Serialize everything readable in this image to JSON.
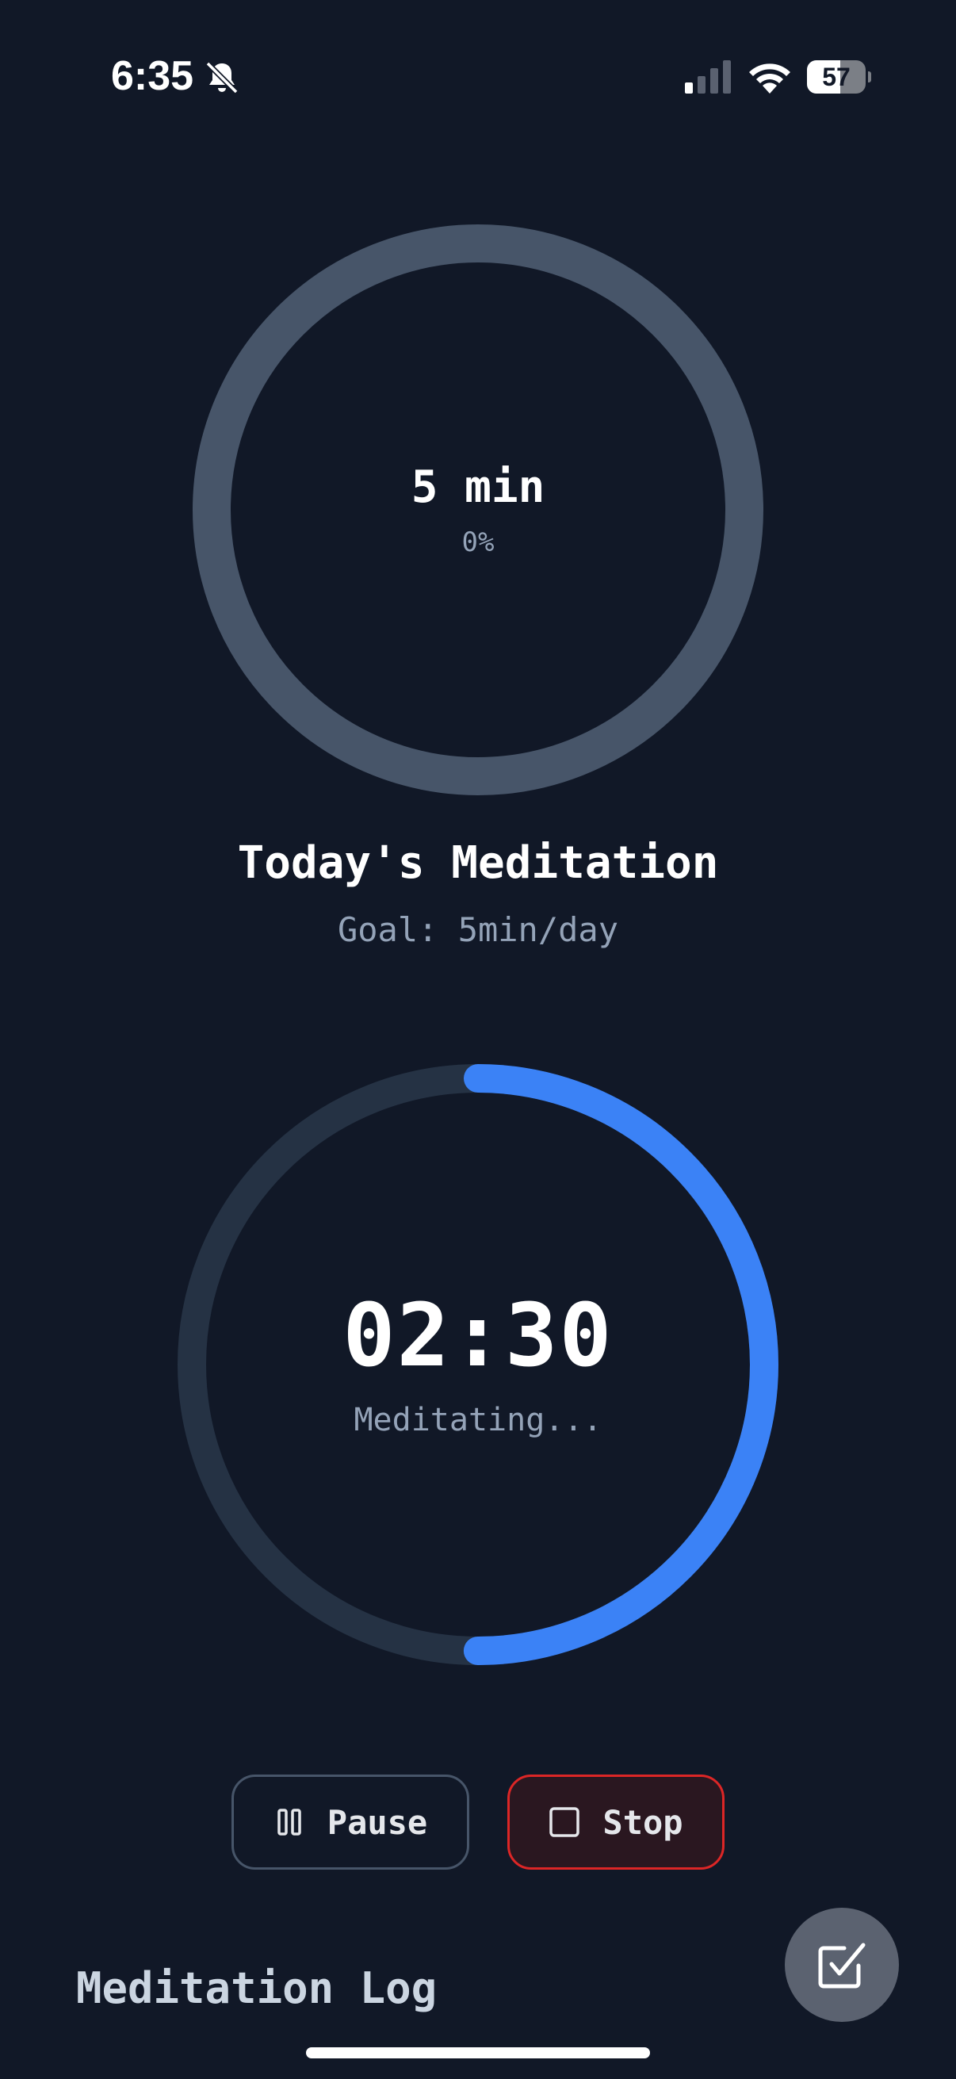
{
  "status_bar": {
    "time": "6:35",
    "battery_level": 57,
    "battery_label": "57",
    "icons": [
      "bell-muted-icon",
      "signal-icon",
      "wifi-icon",
      "battery-icon"
    ]
  },
  "goal": {
    "value_label": "5 min",
    "percent_label": "0%",
    "progress": 0
  },
  "header": {
    "title": "Today's Meditation",
    "subtitle": "Goal: 5min/day"
  },
  "timer": {
    "time": "02:30",
    "status": "Meditating...",
    "progress": 0.5
  },
  "controls": {
    "pause_label": "Pause",
    "stop_label": "Stop"
  },
  "log": {
    "title": "Meditation Log"
  },
  "colors": {
    "background": "#111827",
    "accent": "#3b82f6",
    "ring_track_goal": "#475569",
    "ring_track_timer": "#253244",
    "stop": "#dc2626",
    "muted_text": "#94a3b8"
  }
}
